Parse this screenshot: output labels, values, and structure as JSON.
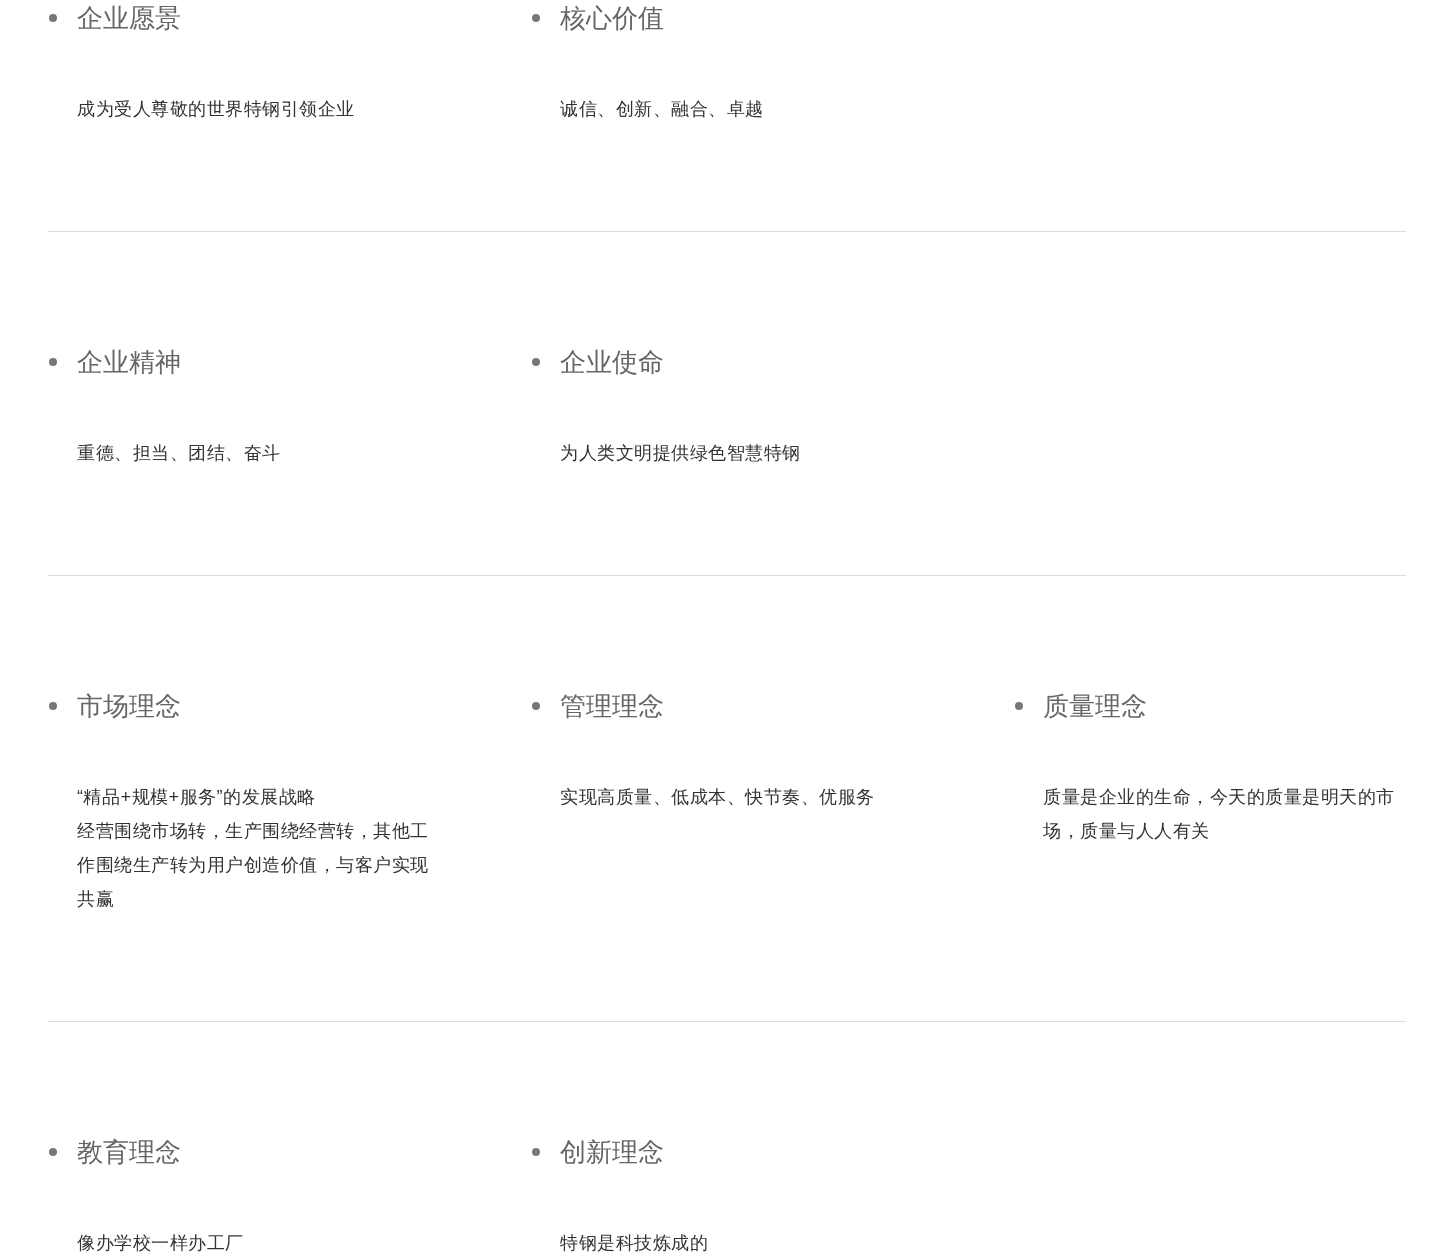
{
  "sections": [
    {
      "items": [
        {
          "title": "企业愿景",
          "paragraphs": [
            "成为受人尊敬的世界特钢引领企业"
          ]
        },
        {
          "title": "核心价值",
          "paragraphs": [
            "诚信、创新、融合、卓越"
          ]
        }
      ]
    },
    {
      "items": [
        {
          "title": "企业精神",
          "paragraphs": [
            "重德、担当、团结、奋斗"
          ]
        },
        {
          "title": "企业使命",
          "paragraphs": [
            "为人类文明提供绿色智慧特钢"
          ]
        }
      ]
    },
    {
      "items": [
        {
          "title": "市场理念",
          "paragraphs": [
            "“精品+规模+服务”的发展战略",
            "经营围绕市场转，生产围绕经营转，其他工作围绕生产转为用户创造价值，与客户实现共赢"
          ]
        },
        {
          "title": "管理理念",
          "paragraphs": [
            "实现高质量、低成本、快节奏、优服务"
          ]
        },
        {
          "title": "质量理念",
          "paragraphs": [
            "质量是企业的生命，今天的质量是明天的市场，质量与人人有关"
          ]
        }
      ]
    },
    {
      "items": [
        {
          "title": "教育理念",
          "paragraphs": [
            "像办学校一样办工厂"
          ]
        },
        {
          "title": "创新理念",
          "paragraphs": [
            "特钢是科技炼成的"
          ]
        }
      ]
    }
  ]
}
